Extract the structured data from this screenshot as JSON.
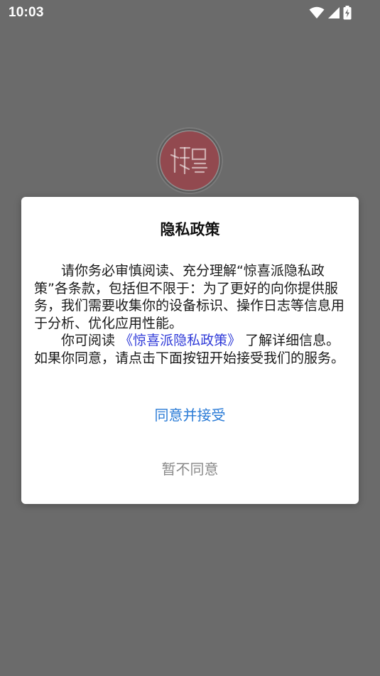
{
  "status_bar": {
    "time": "10:03",
    "icons": [
      "wifi-icon",
      "cellular-signal-icon",
      "battery-charging-icon"
    ]
  },
  "app": {
    "logo_icon": "app-logo-icon",
    "logo_color": "#b5333f"
  },
  "dialog": {
    "title": "隐私政策",
    "paragraph1": "请你务必审慎阅读、充分理解“惊喜派隐私政策”各条款，包括但不限于：为了更好的向你提供服务，我们需要收集你的设备标识、操作日志等信息用于分析、优化应用性能。",
    "paragraph2_before": "你可阅读",
    "policy_link": "《惊喜派隐私政策》",
    "paragraph2_after": "了解详细信息。如果你同意，请点击下面按钮开始接受我们的服务。",
    "accept_label": "同意并接受",
    "decline_label": "暂不同意"
  },
  "colors": {
    "overlay": "#6b6b6b",
    "accept": "#2a7bd6",
    "link": "#2f3ad8",
    "decline": "#8a8a8a"
  }
}
